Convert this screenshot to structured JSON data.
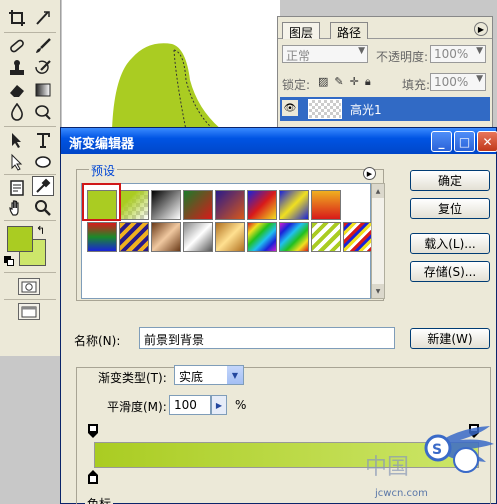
{
  "canvas": {
    "layer_shape_color": "#aacc22"
  },
  "layers_panel": {
    "tabs": [
      "图层",
      "路径"
    ],
    "blend_mode": "正常",
    "opacity_label": "不透明度:",
    "opacity_value": "100%",
    "lock_label": "锁定:",
    "fill_label": "填充:",
    "fill_value": "100%",
    "layer_name": "高光1"
  },
  "toolbox": {
    "foreground_color": "#aacc22",
    "background_color": "#cde66a"
  },
  "dialog": {
    "title": "渐变编辑器",
    "presets_label": "预设",
    "buttons": {
      "ok": "确定",
      "reset": "复位",
      "load": "载入(L)...",
      "save": "存储(S)...",
      "new": "新建(W)"
    },
    "name_label": "名称(N):",
    "name_value": "前景到背景",
    "gradient_type_label": "渐变类型(T):",
    "gradient_type_value": "实底",
    "smoothness_label": "平滑度(M):",
    "smoothness_value": "100",
    "smoothness_unit": "%",
    "stops_label": "色标",
    "gradient_start_color": "#aacc22",
    "gradient_end_color": "#cde66a"
  },
  "watermark": {
    "text": "jcwcn.com",
    "cn_text": "中国"
  }
}
